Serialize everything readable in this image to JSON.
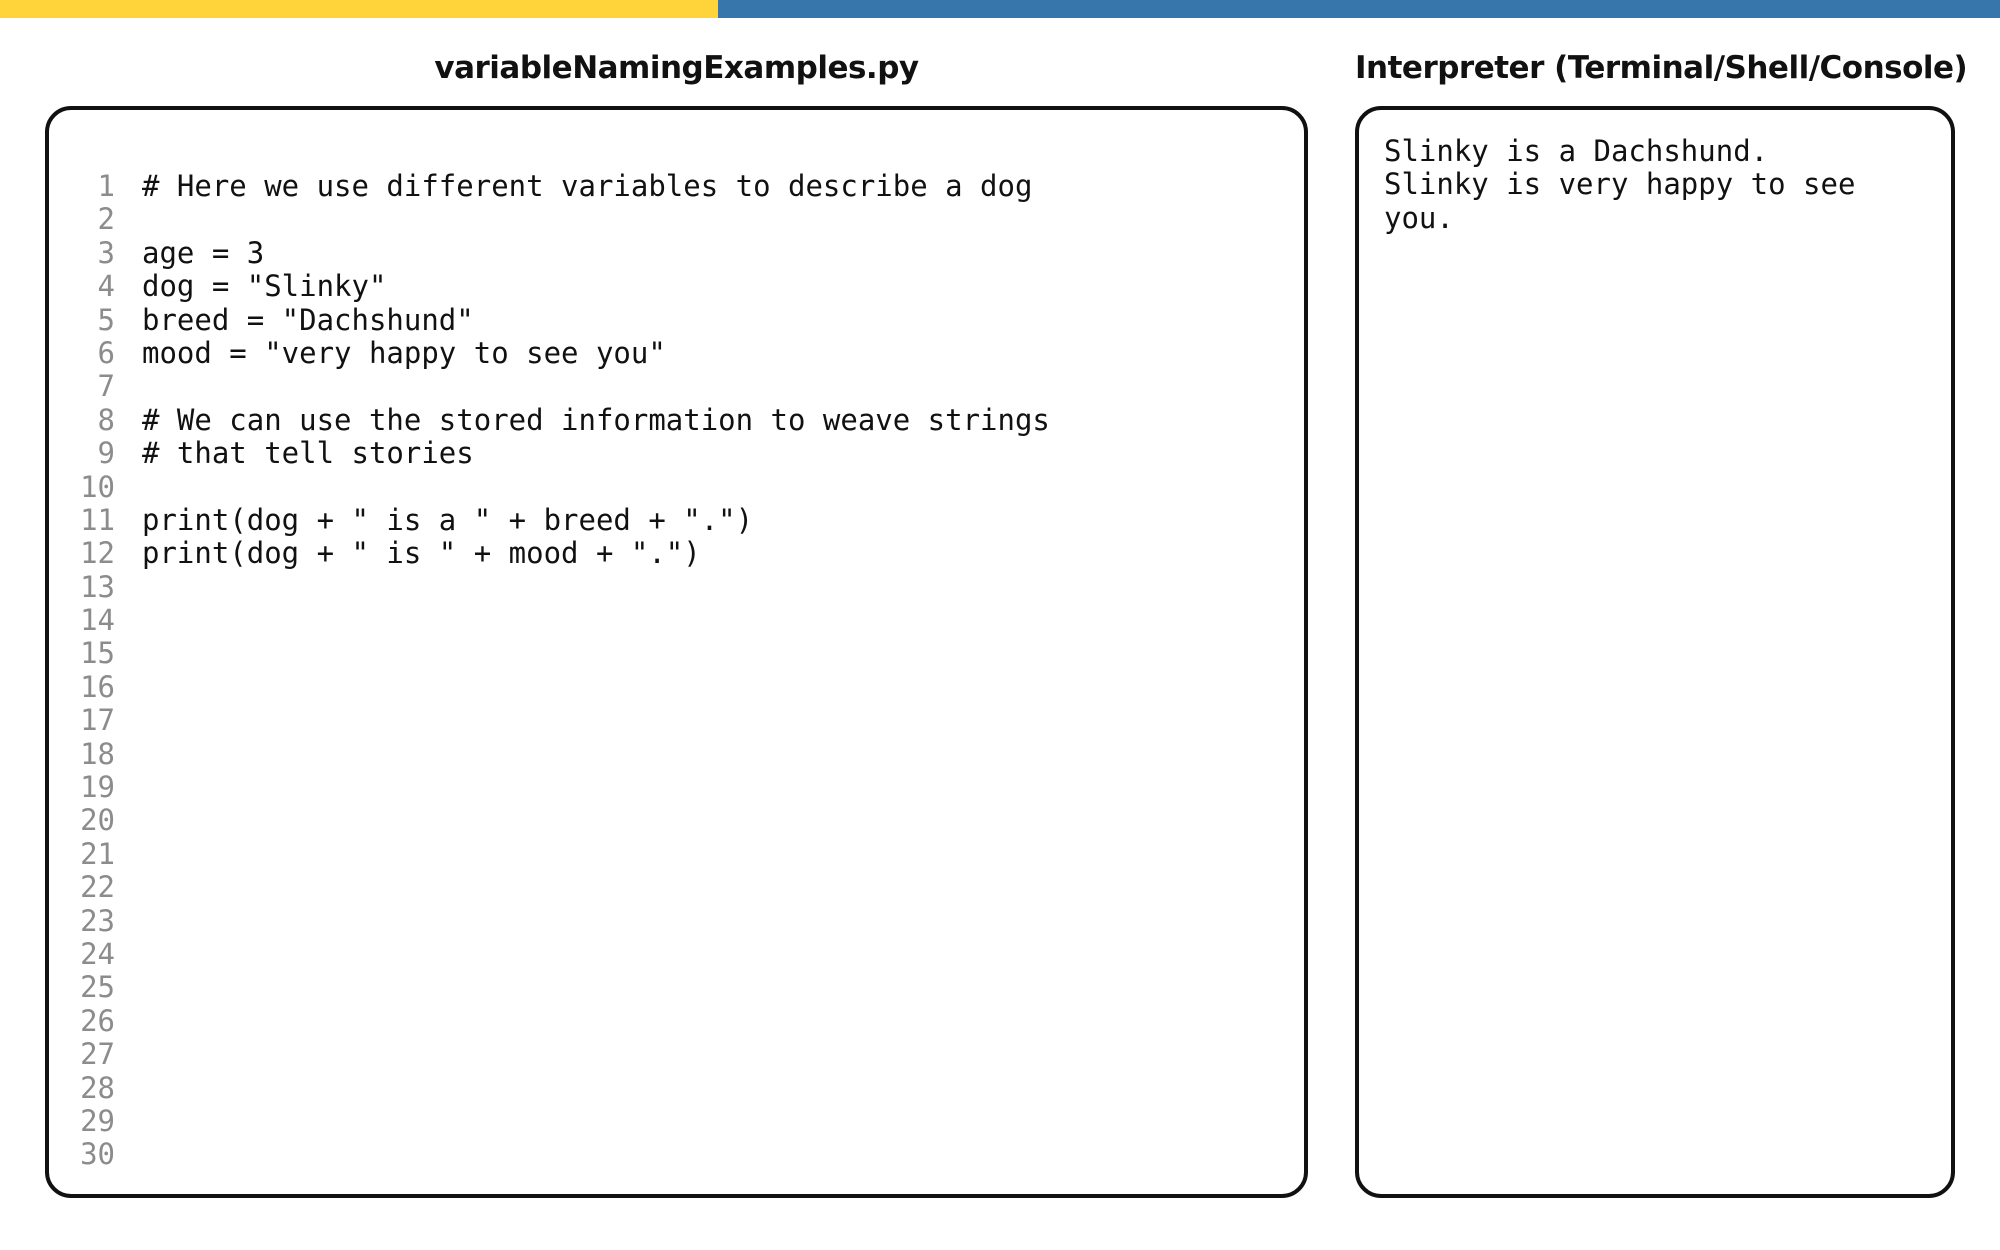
{
  "colors": {
    "accent_yellow": "#ffd43b",
    "accent_blue": "#3776ab"
  },
  "editor": {
    "title": "variableNamingExamples.py",
    "lines": [
      "# Here we use different variables to describe a dog",
      "",
      "age = 3",
      "dog = \"Slinky\"",
      "breed = \"Dachshund\"",
      "mood = \"very happy to see you\"",
      "",
      "# We can use the stored information to weave strings",
      "# that tell stories",
      "",
      "print(dog + \" is a \" + breed + \".\")",
      "print(dog + \" is \" + mood + \".\")",
      "",
      "",
      "",
      "",
      "",
      "",
      "",
      "",
      "",
      "",
      "",
      "",
      "",
      "",
      "",
      "",
      "",
      ""
    ]
  },
  "console": {
    "title": "Interpreter (Terminal/Shell/Console)",
    "output_lines": [
      "Slinky is a Dachshund.",
      "Slinky is very happy to see",
      "you."
    ]
  }
}
